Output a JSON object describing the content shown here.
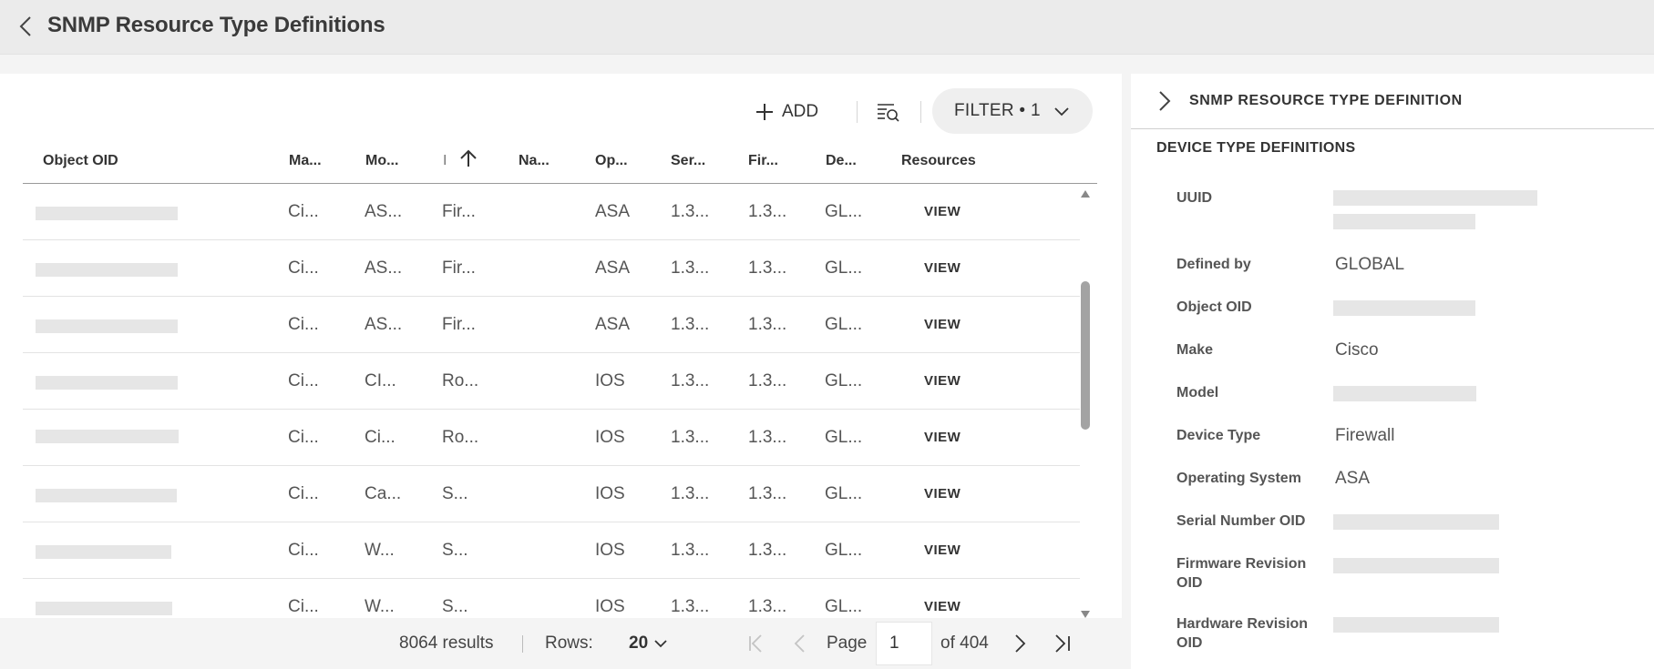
{
  "header": {
    "title": "SNMP Resource Type Definitions"
  },
  "toolbar": {
    "add_label": "ADD",
    "filter_label": "FILTER • 1"
  },
  "table": {
    "columns": [
      "Object OID",
      "Ma...",
      "Mo...",
      "I",
      "Na...",
      "Op...",
      "Ser...",
      "Fir...",
      "De...",
      "Resources"
    ],
    "sort": {
      "column": "I",
      "direction": "ascending"
    },
    "rows": [
      {
        "make": "Ci...",
        "model": "AS...",
        "type": "Fir...",
        "name": "",
        "os": "ASA",
        "serial": "1.3...",
        "firmware": "1.3...",
        "defined": "GL...",
        "resources": "VIEW"
      },
      {
        "make": "Ci...",
        "model": "AS...",
        "type": "Fir...",
        "name": "",
        "os": "ASA",
        "serial": "1.3...",
        "firmware": "1.3...",
        "defined": "GL...",
        "resources": "VIEW"
      },
      {
        "make": "Ci...",
        "model": "AS...",
        "type": "Fir...",
        "name": "",
        "os": "ASA",
        "serial": "1.3...",
        "firmware": "1.3...",
        "defined": "GL...",
        "resources": "VIEW"
      },
      {
        "make": "Ci...",
        "model": "CI...",
        "type": "Ro...",
        "name": "",
        "os": "IOS",
        "serial": "1.3...",
        "firmware": "1.3...",
        "defined": "GL...",
        "resources": "VIEW"
      },
      {
        "make": "Ci...",
        "model": "Ci...",
        "type": "Ro...",
        "name": "",
        "os": "IOS",
        "serial": "1.3...",
        "firmware": "1.3...",
        "defined": "GL...",
        "resources": "VIEW"
      },
      {
        "make": "Ci...",
        "model": "Ca...",
        "type": "S...",
        "name": "",
        "os": "IOS",
        "serial": "1.3...",
        "firmware": "1.3...",
        "defined": "GL...",
        "resources": "VIEW"
      },
      {
        "make": "Ci...",
        "model": "W...",
        "type": "S...",
        "name": "",
        "os": "IOS",
        "serial": "1.3...",
        "firmware": "1.3...",
        "defined": "GL...",
        "resources": "VIEW"
      },
      {
        "make": "Ci...",
        "model": "W...",
        "type": "S...",
        "name": "",
        "os": "IOS",
        "serial": "1.3...",
        "firmware": "1.3...",
        "defined": "GL...",
        "resources": "VIEW"
      }
    ]
  },
  "pagination": {
    "results": "8064 results",
    "rows_label": "Rows:",
    "rows_value": "20",
    "page_label": "Page",
    "page_value": "1",
    "of_label": "of 404"
  },
  "detail": {
    "title": "SNMP RESOURCE TYPE DEFINITION",
    "section": "DEVICE TYPE DEFINITIONS",
    "fields": {
      "uuid_label": "UUID",
      "defined_by_label": "Defined by",
      "defined_by_value": "GLOBAL",
      "object_oid_label": "Object OID",
      "make_label": "Make",
      "make_value": "Cisco",
      "model_label": "Model",
      "device_type_label": "Device Type",
      "device_type_value": "Firewall",
      "os_label": "Operating System",
      "os_value": "ASA",
      "serial_label": "Serial Number OID",
      "firmware_label": "Firmware Revision OID",
      "hardware_label": "Hardware Revision OID"
    }
  },
  "icons": {
    "back": "chevron-left-icon",
    "add": "plus-icon",
    "search": "list-search-icon",
    "filter_toggle": "chevron-down-icon",
    "sort": "arrow-up-icon",
    "first_page": "first-page-icon",
    "prev_page": "chevron-left-icon",
    "next_page": "chevron-right-icon",
    "last_page": "last-page-icon",
    "detail_toggle": "chevron-right-icon"
  },
  "colors": {
    "placeholder": "#e6e6e6",
    "header_bg": "#ebebeb",
    "filter_bg": "#efefef",
    "scroll_thumb": "#a3a3a3"
  }
}
